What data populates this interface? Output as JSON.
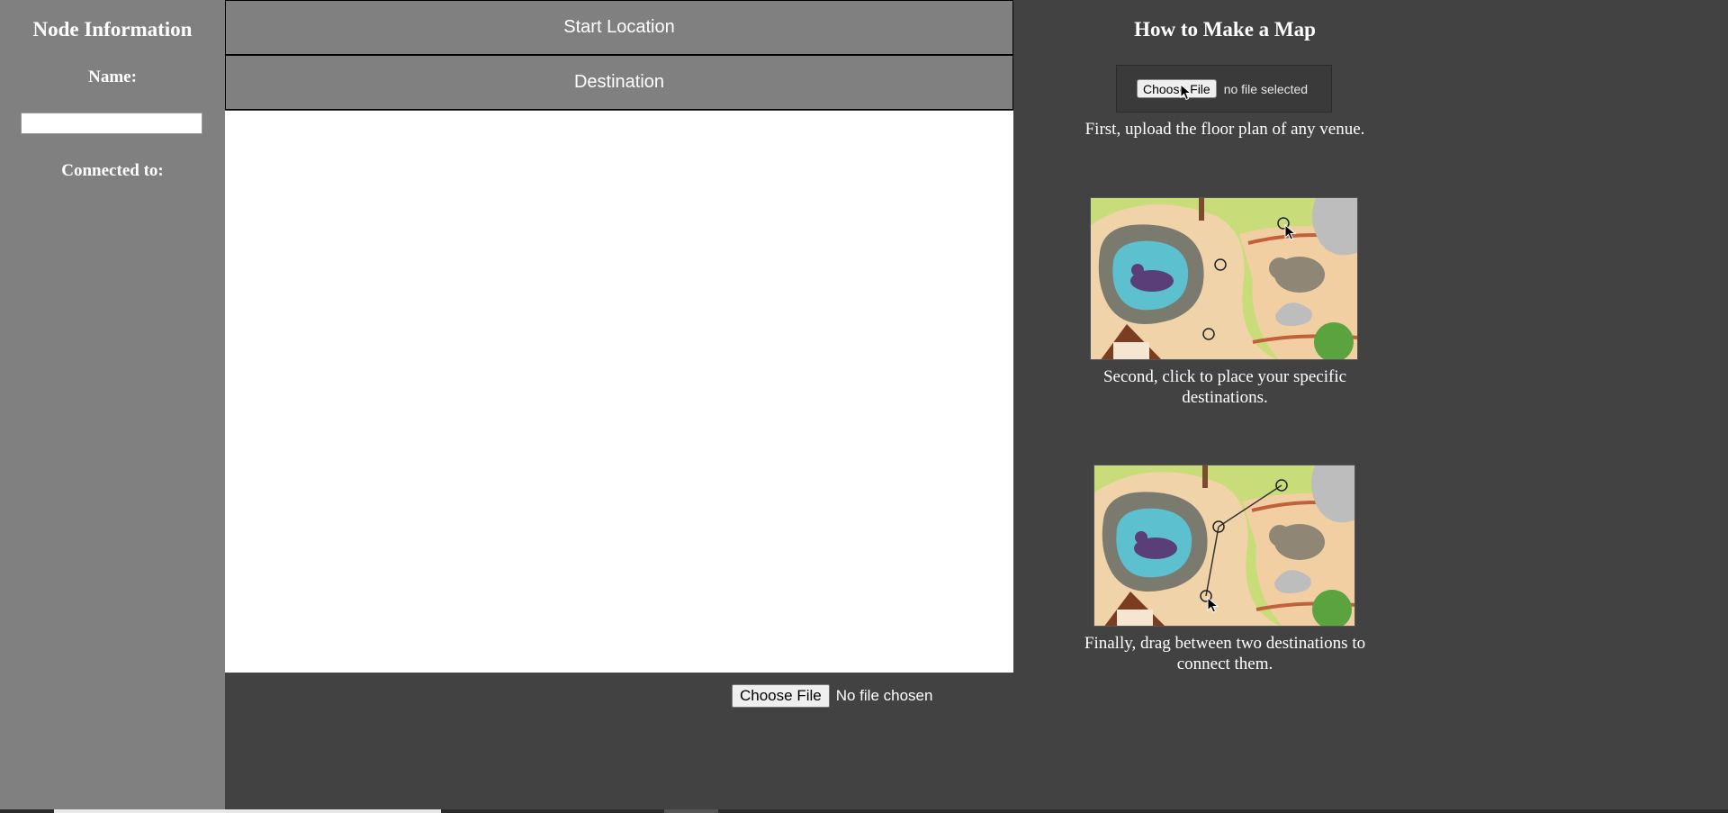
{
  "sidebar": {
    "title": "Node Information",
    "name_label": "Name:",
    "name_value": "",
    "connected_label": "Connected to:"
  },
  "center": {
    "start_location_label": "Start Location",
    "destination_label": "Destination",
    "file_button_label": "Choose File",
    "file_status": "No file chosen"
  },
  "help": {
    "title": "How to Make a Map",
    "upload_button_label": "Choose File",
    "upload_status": "no file selected",
    "step1": "First, upload the floor plan of any venue.",
    "step2": "Second, click to place your specific destinations.",
    "step3": "Finally, drag between two destinations to connect them."
  },
  "colors": {
    "sidebar_bg": "#808080",
    "page_bg": "#424242",
    "canvas_bg": "#ffffff"
  }
}
